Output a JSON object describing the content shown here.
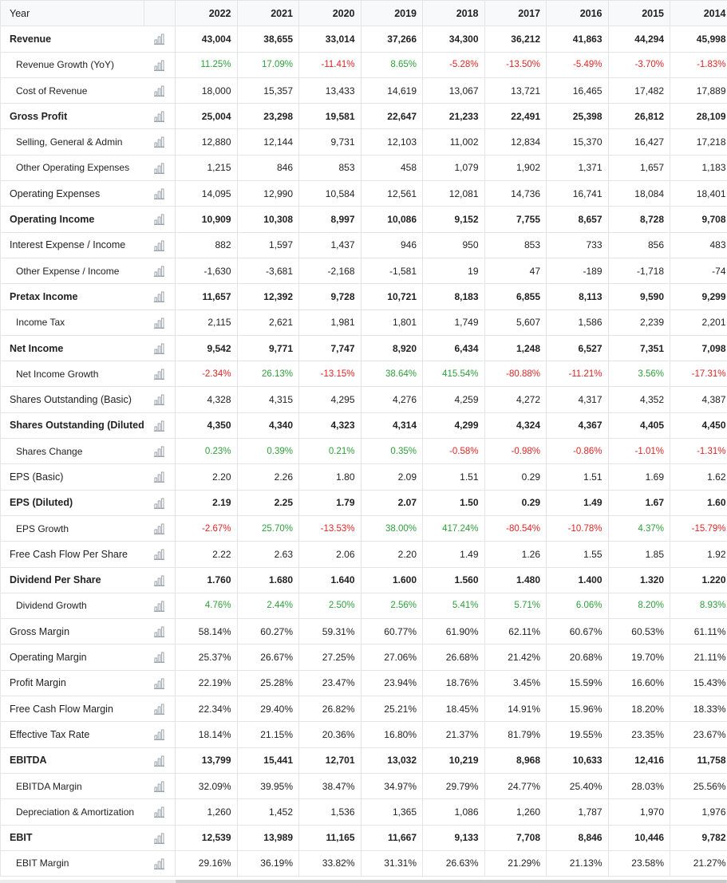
{
  "table": {
    "year_label": "Year",
    "years": [
      "2022",
      "2021",
      "2020",
      "2019",
      "2018",
      "2017",
      "2016",
      "2015",
      "2014"
    ],
    "rows": [
      {
        "label": "Revenue",
        "values": [
          "43,004",
          "38,655",
          "33,014",
          "37,266",
          "34,300",
          "36,212",
          "41,863",
          "44,294",
          "45,998"
        ]
      },
      {
        "label": "Revenue Growth (YoY)",
        "values": [
          "11.25%",
          "17.09%",
          "-11.41%",
          "8.65%",
          "-5.28%",
          "-13.50%",
          "-5.49%",
          "-3.70%",
          "-1.83%"
        ]
      },
      {
        "label": "Cost of Revenue",
        "values": [
          "18,000",
          "15,357",
          "13,433",
          "14,619",
          "13,067",
          "13,721",
          "16,465",
          "17,482",
          "17,889"
        ]
      },
      {
        "label": "Gross Profit",
        "values": [
          "25,004",
          "23,298",
          "19,581",
          "22,647",
          "21,233",
          "22,491",
          "25,398",
          "26,812",
          "28,109"
        ]
      },
      {
        "label": "Selling, General & Admin",
        "values": [
          "12,880",
          "12,144",
          "9,731",
          "12,103",
          "11,002",
          "12,834",
          "15,370",
          "16,427",
          "17,218"
        ]
      },
      {
        "label": "Other Operating Expenses",
        "values": [
          "1,215",
          "846",
          "853",
          "458",
          "1,079",
          "1,902",
          "1,371",
          "1,657",
          "1,183"
        ]
      },
      {
        "label": "Operating Expenses",
        "values": [
          "14,095",
          "12,990",
          "10,584",
          "12,561",
          "12,081",
          "14,736",
          "16,741",
          "18,084",
          "18,401"
        ]
      },
      {
        "label": "Operating Income",
        "values": [
          "10,909",
          "10,308",
          "8,997",
          "10,086",
          "9,152",
          "7,755",
          "8,657",
          "8,728",
          "9,708"
        ]
      },
      {
        "label": "Interest Expense / Income",
        "values": [
          "882",
          "1,597",
          "1,437",
          "946",
          "950",
          "853",
          "733",
          "856",
          "483"
        ]
      },
      {
        "label": "Other Expense / Income",
        "values": [
          "-1,630",
          "-3,681",
          "-2,168",
          "-1,581",
          "19",
          "47",
          "-189",
          "-1,718",
          "-74"
        ]
      },
      {
        "label": "Pretax Income",
        "values": [
          "11,657",
          "12,392",
          "9,728",
          "10,721",
          "8,183",
          "6,855",
          "8,113",
          "9,590",
          "9,299"
        ]
      },
      {
        "label": "Income Tax",
        "values": [
          "2,115",
          "2,621",
          "1,981",
          "1,801",
          "1,749",
          "5,607",
          "1,586",
          "2,239",
          "2,201"
        ]
      },
      {
        "label": "Net Income",
        "values": [
          "9,542",
          "9,771",
          "7,747",
          "8,920",
          "6,434",
          "1,248",
          "6,527",
          "7,351",
          "7,098"
        ]
      },
      {
        "label": "Net Income Growth",
        "values": [
          "-2.34%",
          "26.13%",
          "-13.15%",
          "38.64%",
          "415.54%",
          "-80.88%",
          "-11.21%",
          "3.56%",
          "-17.31%"
        ]
      },
      {
        "label": "Shares Outstanding (Basic)",
        "values": [
          "4,328",
          "4,315",
          "4,295",
          "4,276",
          "4,259",
          "4,272",
          "4,317",
          "4,352",
          "4,387"
        ]
      },
      {
        "label": "Shares Outstanding (Diluted)",
        "values": [
          "4,350",
          "4,340",
          "4,323",
          "4,314",
          "4,299",
          "4,324",
          "4,367",
          "4,405",
          "4,450"
        ]
      },
      {
        "label": "Shares Change",
        "values": [
          "0.23%",
          "0.39%",
          "0.21%",
          "0.35%",
          "-0.58%",
          "-0.98%",
          "-0.86%",
          "-1.01%",
          "-1.31%"
        ]
      },
      {
        "label": "EPS (Basic)",
        "values": [
          "2.20",
          "2.26",
          "1.80",
          "2.09",
          "1.51",
          "0.29",
          "1.51",
          "1.69",
          "1.62"
        ]
      },
      {
        "label": "EPS (Diluted)",
        "values": [
          "2.19",
          "2.25",
          "1.79",
          "2.07",
          "1.50",
          "0.29",
          "1.49",
          "1.67",
          "1.60"
        ]
      },
      {
        "label": "EPS Growth",
        "values": [
          "-2.67%",
          "25.70%",
          "-13.53%",
          "38.00%",
          "417.24%",
          "-80.54%",
          "-10.78%",
          "4.37%",
          "-15.79%"
        ]
      },
      {
        "label": "Free Cash Flow Per Share",
        "values": [
          "2.22",
          "2.63",
          "2.06",
          "2.20",
          "1.49",
          "1.26",
          "1.55",
          "1.85",
          "1.92"
        ]
      },
      {
        "label": "Dividend Per Share",
        "values": [
          "1.760",
          "1.680",
          "1.640",
          "1.600",
          "1.560",
          "1.480",
          "1.400",
          "1.320",
          "1.220"
        ]
      },
      {
        "label": "Dividend Growth",
        "values": [
          "4.76%",
          "2.44%",
          "2.50%",
          "2.56%",
          "5.41%",
          "5.71%",
          "6.06%",
          "8.20%",
          "8.93%"
        ]
      },
      {
        "label": "Gross Margin",
        "values": [
          "58.14%",
          "60.27%",
          "59.31%",
          "60.77%",
          "61.90%",
          "62.11%",
          "60.67%",
          "60.53%",
          "61.11%"
        ]
      },
      {
        "label": "Operating Margin",
        "values": [
          "25.37%",
          "26.67%",
          "27.25%",
          "27.06%",
          "26.68%",
          "21.42%",
          "20.68%",
          "19.70%",
          "21.11%"
        ]
      },
      {
        "label": "Profit Margin",
        "values": [
          "22.19%",
          "25.28%",
          "23.47%",
          "23.94%",
          "18.76%",
          "3.45%",
          "15.59%",
          "16.60%",
          "15.43%"
        ]
      },
      {
        "label": "Free Cash Flow Margin",
        "values": [
          "22.34%",
          "29.40%",
          "26.82%",
          "25.21%",
          "18.45%",
          "14.91%",
          "15.96%",
          "18.20%",
          "18.33%"
        ]
      },
      {
        "label": "Effective Tax Rate",
        "values": [
          "18.14%",
          "21.15%",
          "20.36%",
          "16.80%",
          "21.37%",
          "81.79%",
          "19.55%",
          "23.35%",
          "23.67%"
        ]
      },
      {
        "label": "EBITDA",
        "values": [
          "13,799",
          "15,441",
          "12,701",
          "13,032",
          "10,219",
          "8,968",
          "10,633",
          "12,416",
          "11,758"
        ]
      },
      {
        "label": "EBITDA Margin",
        "values": [
          "32.09%",
          "39.95%",
          "38.47%",
          "34.97%",
          "29.79%",
          "24.77%",
          "25.40%",
          "28.03%",
          "25.56%"
        ]
      },
      {
        "label": "Depreciation & Amortization",
        "values": [
          "1,260",
          "1,452",
          "1,536",
          "1,365",
          "1,086",
          "1,260",
          "1,787",
          "1,970",
          "1,976"
        ]
      },
      {
        "label": "EBIT",
        "values": [
          "12,539",
          "13,989",
          "11,165",
          "11,667",
          "9,133",
          "7,708",
          "8,846",
          "10,446",
          "9,782"
        ]
      },
      {
        "label": "EBIT Margin",
        "values": [
          "29.16%",
          "36.19%",
          "33.82%",
          "31.31%",
          "26.63%",
          "21.29%",
          "21.13%",
          "23.58%",
          "21.27%"
        ]
      }
    ]
  },
  "row_icon": "bar-chart-icon",
  "colors": {
    "positive": "#2e9e3a",
    "negative": "#dc2626",
    "border": "#e1e4e8",
    "header_bg": "#f8f9fb"
  }
}
